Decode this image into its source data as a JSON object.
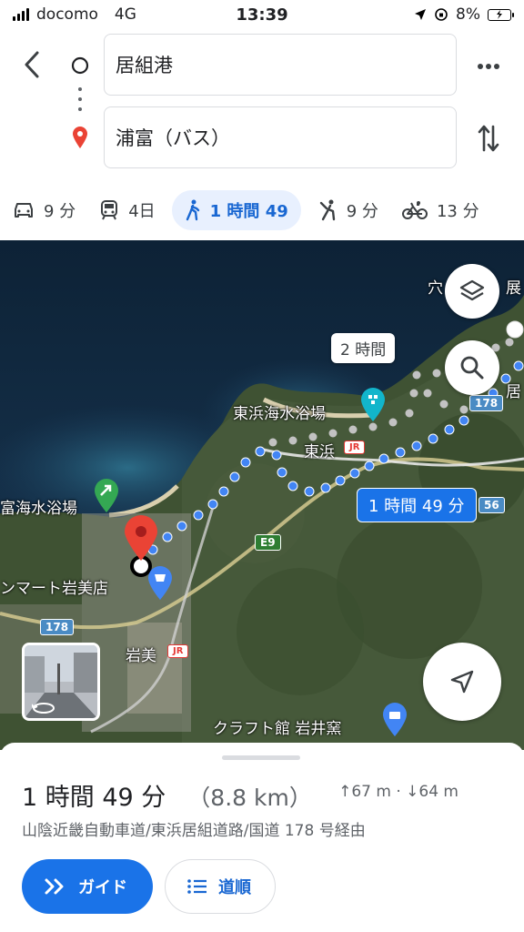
{
  "status_bar": {
    "carrier": "docomo",
    "network": "4G",
    "time": "13:39",
    "battery": "8%"
  },
  "route": {
    "origin": "居組港",
    "destination": "浦富（バス）"
  },
  "modes": [
    {
      "icon": "car-icon",
      "label": "9 分"
    },
    {
      "icon": "train-icon",
      "label": "4日"
    },
    {
      "icon": "walk-icon",
      "label": "1 時間 49",
      "active": true
    },
    {
      "icon": "ride-hail-icon",
      "label": "9 分"
    },
    {
      "icon": "bicycle-icon",
      "label": "13 分"
    }
  ],
  "map": {
    "labels": {
      "beach_east": "東浜海水浴場",
      "beach_west": "富海水浴場",
      "station_higashihama": "東浜",
      "store": "ンマート岩美店",
      "station_iwami": "岩美",
      "craft": "クラフト館 岩井窯",
      "poi_top": "穴",
      "poi_top_2": "展",
      "poi_right": "居"
    },
    "callouts": {
      "alt_route": "2 時間",
      "main_route": "1 時間 49 分"
    },
    "shields": {
      "e9": "E9",
      "r178_a": "178",
      "r178_b": "178",
      "r56": "56",
      "jr": "JR"
    },
    "colors": {
      "route": "#4285f4",
      "alt_route": "#bdbdbd",
      "pin": "#ea4335",
      "callout": "#1a73e8"
    }
  },
  "sheet": {
    "duration": "1 時間 49 分",
    "distance": "（8.8 km）",
    "elevation": "↑67 m · ↓64 m",
    "via": "山陰近畿自動車道/東浜居組道路/国道 178 号経由",
    "guide_label": "ガイド",
    "steps_label": "道順"
  }
}
